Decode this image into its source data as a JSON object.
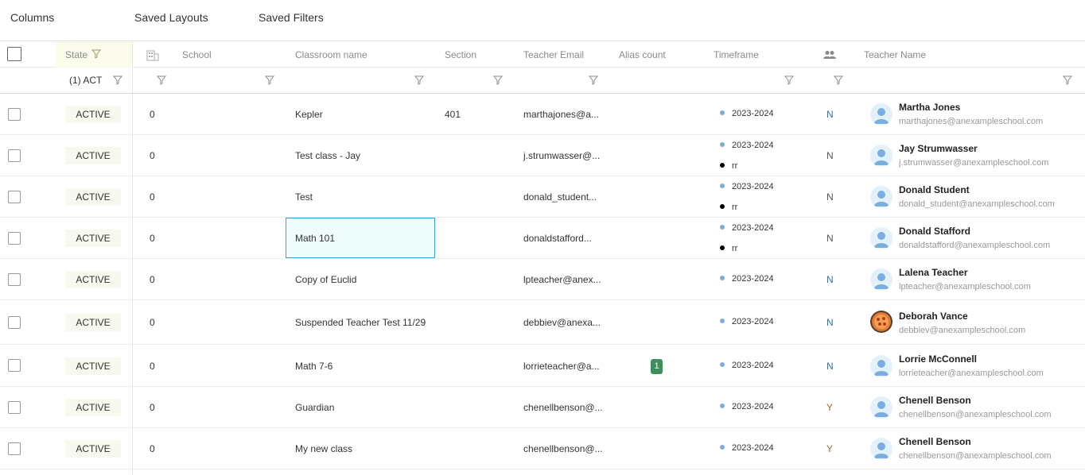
{
  "toolbar": {
    "columns": "Columns",
    "saved_layouts": "Saved Layouts",
    "saved_filters": "Saved Filters"
  },
  "columns": {
    "state": "State",
    "school": "School",
    "classroom_name": "Classroom name",
    "section": "Section",
    "teacher_email": "Teacher Email",
    "alias_count": "Alias count",
    "timeframe": "Timeframe",
    "teacher_name": "Teacher Name"
  },
  "filters": {
    "state_value": "(1) ACT"
  },
  "rows": [
    {
      "state": "ACTIVE",
      "school": "0",
      "classroom": "Kepler",
      "section": "401",
      "email": "marthajones@a...",
      "timeframes": [
        "2023-2024"
      ],
      "flag": "N",
      "name": "Martha Jones",
      "name_email": "marthajones@anexampleschool.com"
    },
    {
      "state": "ACTIVE",
      "school": "0",
      "classroom": "Test class - Jay",
      "section": "",
      "email": "j.strumwasser@...",
      "timeframes": [
        "2023-2024",
        "rr"
      ],
      "flag": "N",
      "name": "Jay Strumwasser",
      "name_email": "j.strumwasser@anexampleschool.com"
    },
    {
      "state": "ACTIVE",
      "school": "0",
      "classroom": "Test",
      "section": "",
      "email": "donald_student...",
      "timeframes": [
        "2023-2024",
        "rr"
      ],
      "flag": "N",
      "name": "Donald Student",
      "name_email": "donald_student@anexampleschool.com"
    },
    {
      "state": "ACTIVE",
      "school": "0",
      "classroom": "Math 101",
      "section": "",
      "email": "donaldstafford...",
      "timeframes": [
        "2023-2024",
        "rr"
      ],
      "flag": "N",
      "name": "Donald Stafford",
      "name_email": "donaldstafford@anexampleschool.com"
    },
    {
      "state": "ACTIVE",
      "school": "0",
      "classroom": "Copy of Euclid",
      "section": "",
      "email": "lpteacher@anex...",
      "timeframes": [
        "2023-2024"
      ],
      "flag": "N",
      "name": "Lalena Teacher",
      "name_email": "lpteacher@anexampleschool.com"
    },
    {
      "state": "ACTIVE",
      "school": "0",
      "classroom": "Suspended Teacher Test 11/29",
      "section": "",
      "email": "debbiev@anexa...",
      "timeframes": [
        "2023-2024"
      ],
      "flag": "N",
      "name": "Deborah Vance",
      "name_email": "debbiev@anexampleschool.com"
    },
    {
      "state": "ACTIVE",
      "school": "0",
      "classroom": "Math 7-6",
      "section": "",
      "email": "lorrieteacher@a...",
      "alias": "1",
      "timeframes": [
        "2023-2024"
      ],
      "flag": "N",
      "name": "Lorrie McConnell",
      "name_email": "lorrieteacher@anexampleschool.com"
    },
    {
      "state": "ACTIVE",
      "school": "0",
      "classroom": "Guardian",
      "section": "",
      "email": "chenellbenson@...",
      "timeframes": [
        "2023-2024"
      ],
      "flag": "Y",
      "name": "Chenell Benson",
      "name_email": "chenellbenson@anexampleschool.com"
    },
    {
      "state": "ACTIVE",
      "school": "0",
      "classroom": "My new class",
      "section": "",
      "email": "chenellbenson@...",
      "timeframes": [
        "2023-2024"
      ],
      "flag": "Y",
      "name": "Chenell Benson",
      "name_email": "chenellbenson@anexampleschool.com"
    }
  ],
  "colors": {
    "accent": "#3aa0d8",
    "alias_badge": "#3f8f5c",
    "state_bg": "#fbfcec",
    "timeframe_dot": "#7baee0"
  }
}
